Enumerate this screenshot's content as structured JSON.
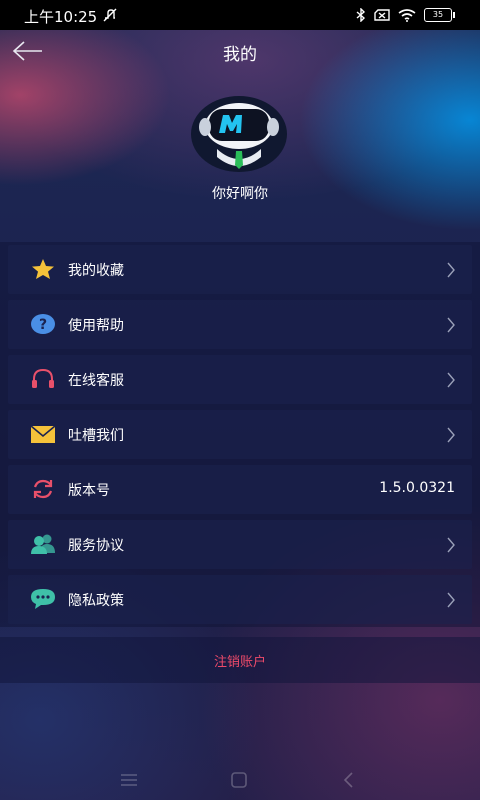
{
  "status_bar": {
    "time": "上午10:25",
    "battery": "35",
    "icons": [
      "mute-icon",
      "bluetooth-icon",
      "no-sim-icon",
      "wifi-icon",
      "battery-icon"
    ]
  },
  "header": {
    "title": "我的",
    "back_icon": "back-arrow-icon"
  },
  "profile": {
    "username": "你好啊你",
    "avatar_letter": "M"
  },
  "menu": {
    "items": [
      {
        "label": "我的收藏",
        "icon": "star-icon",
        "icon_color": "#f5c23a"
      },
      {
        "label": "使用帮助",
        "icon": "question-icon",
        "icon_color": "#4a8fe6"
      },
      {
        "label": "在线客服",
        "icon": "headset-icon",
        "icon_color": "#e8506a"
      },
      {
        "label": "吐槽我们",
        "icon": "mail-icon",
        "icon_color": "#f5c23a"
      },
      {
        "label": "版本号",
        "icon": "refresh-icon",
        "icon_color": "#e8506a",
        "value": "1.5.0.0321"
      },
      {
        "label": "服务协议",
        "icon": "users-icon",
        "icon_color": "#3fc0a8"
      },
      {
        "label": "隐私政策",
        "icon": "chat-icon",
        "icon_color": "#3fc0a8"
      }
    ]
  },
  "logout": {
    "label": "注销账户",
    "color": "#ec4a6a"
  },
  "nav_bar": {
    "buttons": [
      "menu-icon",
      "home-icon",
      "back-icon"
    ]
  }
}
